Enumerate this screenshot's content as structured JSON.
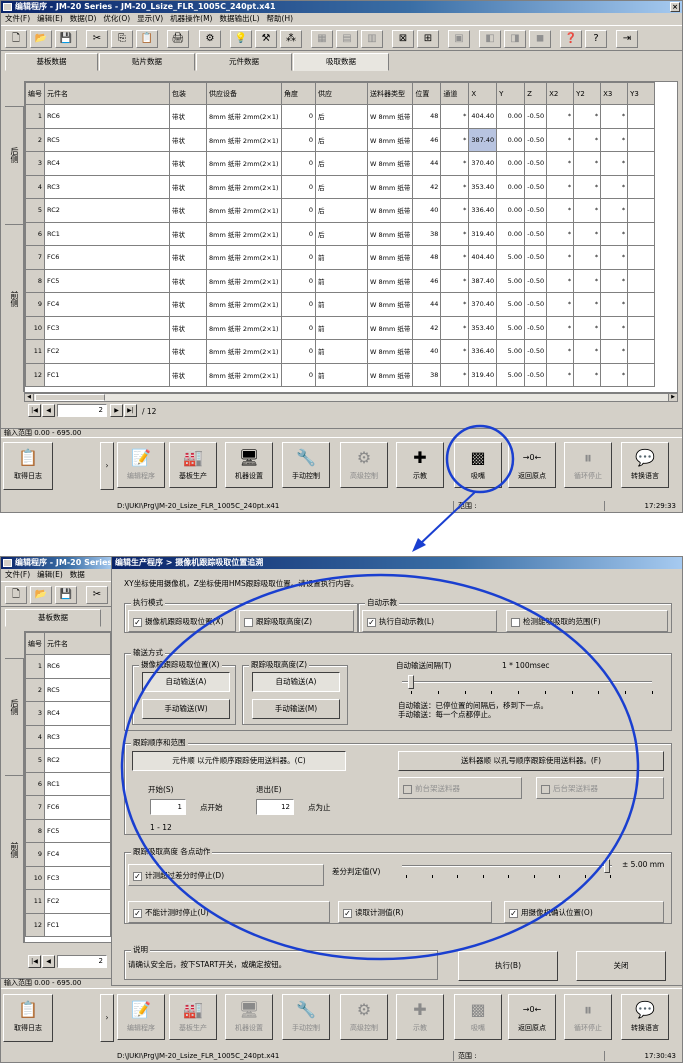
{
  "win1": {
    "title": "编辑程序 - JM-20 Series - JM-20_Lsize_FLR_1005C_240pt.x41"
  },
  "win2": {
    "title": "编辑程序 - JM-20 Series"
  },
  "menu": [
    "文件(F)",
    "编辑(E)",
    "数据(D)",
    "优化(O)",
    "显示(V)",
    "机器操作(M)",
    "数据输出(L)",
    "帮助(H)"
  ],
  "menu2": [
    "文件(F)",
    "编辑(E)",
    "数据"
  ],
  "tabs": [
    "基板数据",
    "贴片数据",
    "元件数据",
    "吸取数据"
  ],
  "tabs2": [
    "基板数据"
  ],
  "grid": {
    "headers": [
      "编号",
      "元件名",
      "包装",
      "供应设备",
      "角度",
      "供应",
      "送料器类型",
      "位置",
      "通道",
      "X",
      "Y",
      "Z",
      "X2",
      "Y2",
      "X3",
      "Y3"
    ],
    "rows": [
      [
        "1",
        "RC6",
        "带状",
        "8mm 纸带 2mm(2×1)",
        "0",
        "后",
        "W 8mm 纸带",
        "48",
        "*",
        "404.40",
        "0.00",
        "-0.50",
        "*",
        "*",
        "*",
        ""
      ],
      [
        "2",
        "RC5",
        "带状",
        "8mm 纸带 2mm(2×1)",
        "0",
        "后",
        "W 8mm 纸带",
        "46",
        "*",
        "387.40",
        "0.00",
        "-0.50",
        "*",
        "*",
        "*",
        ""
      ],
      [
        "3",
        "RC4",
        "带状",
        "8mm 纸带 2mm(2×1)",
        "0",
        "后",
        "W 8mm 纸带",
        "44",
        "*",
        "370.40",
        "0.00",
        "-0.50",
        "*",
        "*",
        "*",
        ""
      ],
      [
        "4",
        "RC3",
        "带状",
        "8mm 纸带 2mm(2×1)",
        "0",
        "后",
        "W 8mm 纸带",
        "42",
        "*",
        "353.40",
        "0.00",
        "-0.50",
        "*",
        "*",
        "*",
        ""
      ],
      [
        "5",
        "RC2",
        "带状",
        "8mm 纸带 2mm(2×1)",
        "0",
        "后",
        "W 8mm 纸带",
        "40",
        "*",
        "336.40",
        "0.00",
        "-0.50",
        "*",
        "*",
        "*",
        ""
      ],
      [
        "6",
        "RC1",
        "带状",
        "8mm 纸带 2mm(2×1)",
        "0",
        "后",
        "W 8mm 纸带",
        "38",
        "*",
        "319.40",
        "0.00",
        "-0.50",
        "*",
        "*",
        "*",
        ""
      ],
      [
        "7",
        "FC6",
        "带状",
        "8mm 纸带 2mm(2×1)",
        "0",
        "前",
        "W 8mm 纸带",
        "48",
        "*",
        "404.40",
        "5.00",
        "-0.50",
        "*",
        "*",
        "*",
        ""
      ],
      [
        "8",
        "FC5",
        "带状",
        "8mm 纸带 2mm(2×1)",
        "0",
        "前",
        "W 8mm 纸带",
        "46",
        "*",
        "387.40",
        "5.00",
        "-0.50",
        "*",
        "*",
        "*",
        ""
      ],
      [
        "9",
        "FC4",
        "带状",
        "8mm 纸带 2mm(2×1)",
        "0",
        "前",
        "W 8mm 纸带",
        "44",
        "*",
        "370.40",
        "5.00",
        "-0.50",
        "*",
        "*",
        "*",
        ""
      ],
      [
        "10",
        "FC3",
        "带状",
        "8mm 纸带 2mm(2×1)",
        "0",
        "前",
        "W 8mm 纸带",
        "42",
        "*",
        "353.40",
        "5.00",
        "-0.50",
        "*",
        "*",
        "*",
        ""
      ],
      [
        "11",
        "FC2",
        "带状",
        "8mm 纸带 2mm(2×1)",
        "0",
        "前",
        "W 8mm 纸带",
        "40",
        "*",
        "336.40",
        "5.00",
        "-0.50",
        "*",
        "*",
        "*",
        ""
      ],
      [
        "12",
        "FC1",
        "带状",
        "8mm 纸带 2mm(2×1)",
        "0",
        "前",
        "W 8mm 纸带",
        "38",
        "*",
        "319.40",
        "5.00",
        "-0.50",
        "*",
        "*",
        "*",
        ""
      ]
    ]
  },
  "side": {
    "rear": "后侧",
    "front": "前侧"
  },
  "nav": {
    "page": "2",
    "total": "/ 12"
  },
  "range": "输入范围 0.00 - 695.00",
  "bottom": {
    "log": "取得日志",
    "b1": "编辑程序",
    "b2": "基板生产",
    "b3": "机器设置",
    "b4": "手动控制",
    "b5": "高级控制",
    "b6": "示教",
    "b7": "吸嘴",
    "b8": "返回原点",
    "b9": "循环停止",
    "b10": "转换语言"
  },
  "path1": "D:\\JUKI\\Prg\\JM-20_Lsize_FLR_1005C_240pt.x41",
  "scope": "范围 :",
  "time1": "17:29:33",
  "time2": "17:30:43",
  "dlg": {
    "title": "编辑生产程序 > 摄像机跟踪吸取位置追溯",
    "intro": "XY坐标使用摄像机，Z坐标使用HMS跟踪吸取位置。请设置执行内容。",
    "exec_mode": "执行模式",
    "cam_track": "摄像机跟踪吸取位置(X)",
    "track_height": "跟踪吸取高度(Z)",
    "auto_teach": "自动示教",
    "exec_auto": "执行自动示教(L)",
    "check_range": "检测能够吸取的范围(F)",
    "feed": "输送方式",
    "cam_pos": "摄像机跟踪吸取位置(X)",
    "track_h": "跟踪吸取高度(Z)",
    "auto1": "自动输送(A)",
    "manual1": "手动输送(W)",
    "auto2": "自动输送(A)",
    "manual2": "手动输送(M)",
    "interval": "自动输送间隔(T)",
    "interval_val": "1 * 100msec",
    "note1": "自动输送：已停位置的间隔后，移到下一点。",
    "note2": "手动输送：每一个点都停止。",
    "order": "跟踪顺序和范围",
    "by_part": "元件顺  以元件顺序跟踪使用送料器。(C)",
    "by_feeder": "送料器顺  以孔号顺序跟踪使用送料器。(F)",
    "start": "开始(S)",
    "start_val": "1",
    "start_unit": "点开始",
    "end": "退出(E)",
    "end_val": "12",
    "end_unit": "点为止",
    "range": "1 - 12",
    "front_f": "前台架送料器",
    "rear_f": "后台架送料器",
    "height_grp": "跟踪吸取高度  各点动作",
    "stop_diff": "计测超过差分时停止(D)",
    "diff_limit": "差分判定值(V)",
    "diff_val": "± 5.00 mm",
    "stop_unmeas": "不能计测时停止(U)",
    "read_val": "读取计测值(R)",
    "cam_confirm": "用摄像机确认位置(O)",
    "desc_title": "说明",
    "desc": "请确认安全后，按下START开关，或确定按钮。",
    "run": "执行(B)",
    "close": "关闭"
  },
  "annotation_color": "#1a3fd0"
}
